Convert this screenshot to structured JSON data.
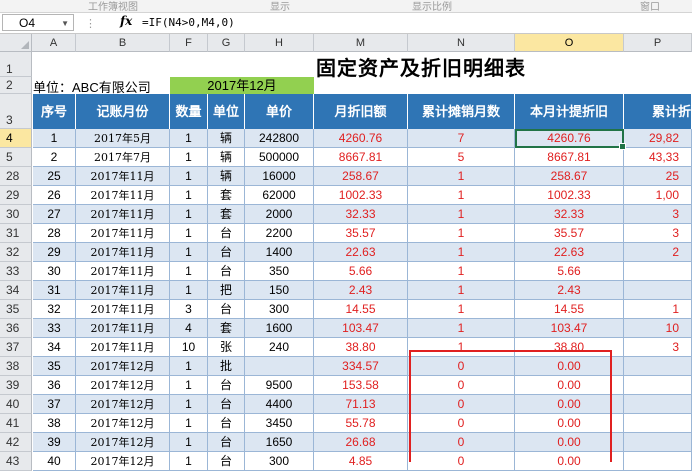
{
  "ribbon": {
    "groups": [
      "工作簿视图",
      "显示",
      "显示比例",
      "窗口"
    ]
  },
  "formula_bar": {
    "name_box": "O4",
    "fx": "fx",
    "formula": "=IF(N4>0,M4,0)"
  },
  "columns": [
    "A",
    "B",
    "F",
    "G",
    "H",
    "M",
    "N",
    "O",
    "P"
  ],
  "selected_column": "O",
  "sheet": {
    "title": "固定资产及折旧明细表",
    "unit": "单位：ABC有限公司",
    "month": "2017年12月"
  },
  "headers": [
    "序号",
    "记账月份",
    "数量",
    "单位",
    "单价",
    "月折旧额",
    "累计摊销月数",
    "本月计提折旧",
    "累计折"
  ],
  "rows": [
    {
      "row": "4",
      "seq": "1",
      "month": "2017年5月",
      "qty": "1",
      "unit": "辆",
      "price": "242800",
      "dep": "4260.76",
      "months": "7",
      "cur": "4260.76",
      "acc": "29,82"
    },
    {
      "row": "5",
      "seq": "2",
      "month": "2017年7月",
      "qty": "1",
      "unit": "辆",
      "price": "500000",
      "dep": "8667.81",
      "months": "5",
      "cur": "8667.81",
      "acc": "43,33"
    },
    {
      "row": "28",
      "seq": "25",
      "month": "2017年11月",
      "qty": "1",
      "unit": "辆",
      "price": "16000",
      "dep": "258.67",
      "months": "1",
      "cur": "258.67",
      "acc": "25"
    },
    {
      "row": "29",
      "seq": "26",
      "month": "2017年11月",
      "qty": "1",
      "unit": "套",
      "price": "62000",
      "dep": "1002.33",
      "months": "1",
      "cur": "1002.33",
      "acc": "1,00"
    },
    {
      "row": "30",
      "seq": "27",
      "month": "2017年11月",
      "qty": "1",
      "unit": "套",
      "price": "2000",
      "dep": "32.33",
      "months": "1",
      "cur": "32.33",
      "acc": "3"
    },
    {
      "row": "31",
      "seq": "28",
      "month": "2017年11月",
      "qty": "1",
      "unit": "台",
      "price": "2200",
      "dep": "35.57",
      "months": "1",
      "cur": "35.57",
      "acc": "3"
    },
    {
      "row": "32",
      "seq": "29",
      "month": "2017年11月",
      "qty": "1",
      "unit": "台",
      "price": "1400",
      "dep": "22.63",
      "months": "1",
      "cur": "22.63",
      "acc": "2"
    },
    {
      "row": "33",
      "seq": "30",
      "month": "2017年11月",
      "qty": "1",
      "unit": "台",
      "price": "350",
      "dep": "5.66",
      "months": "1",
      "cur": "5.66",
      "acc": ""
    },
    {
      "row": "34",
      "seq": "31",
      "month": "2017年11月",
      "qty": "1",
      "unit": "把",
      "price": "150",
      "dep": "2.43",
      "months": "1",
      "cur": "2.43",
      "acc": ""
    },
    {
      "row": "35",
      "seq": "32",
      "month": "2017年11月",
      "qty": "3",
      "unit": "台",
      "price": "300",
      "dep": "14.55",
      "months": "1",
      "cur": "14.55",
      "acc": "1"
    },
    {
      "row": "36",
      "seq": "33",
      "month": "2017年11月",
      "qty": "4",
      "unit": "套",
      "price": "1600",
      "dep": "103.47",
      "months": "1",
      "cur": "103.47",
      "acc": "10"
    },
    {
      "row": "37",
      "seq": "34",
      "month": "2017年11月",
      "qty": "10",
      "unit": "张",
      "price": "240",
      "dep": "38.80",
      "months": "1",
      "cur": "38.80",
      "acc": "3"
    },
    {
      "row": "38",
      "seq": "35",
      "month": "2017年12月",
      "qty": "1",
      "unit": "批",
      "price": "",
      "dep": "334.57",
      "months": "0",
      "cur": "0.00",
      "acc": ""
    },
    {
      "row": "39",
      "seq": "36",
      "month": "2017年12月",
      "qty": "1",
      "unit": "台",
      "price": "9500",
      "dep": "153.58",
      "months": "0",
      "cur": "0.00",
      "acc": ""
    },
    {
      "row": "40",
      "seq": "37",
      "month": "2017年12月",
      "qty": "1",
      "unit": "台",
      "price": "4400",
      "dep": "71.13",
      "months": "0",
      "cur": "0.00",
      "acc": ""
    },
    {
      "row": "41",
      "seq": "38",
      "month": "2017年12月",
      "qty": "1",
      "unit": "台",
      "price": "3450",
      "dep": "55.78",
      "months": "0",
      "cur": "0.00",
      "acc": ""
    },
    {
      "row": "42",
      "seq": "39",
      "month": "2017年12月",
      "qty": "1",
      "unit": "台",
      "price": "1650",
      "dep": "26.68",
      "months": "0",
      "cur": "0.00",
      "acc": ""
    },
    {
      "row": "43",
      "seq": "40",
      "month": "2017年12月",
      "qty": "1",
      "unit": "台",
      "price": "300",
      "dep": "4.85",
      "months": "0",
      "cur": "0.00",
      "acc": ""
    }
  ],
  "colors": {
    "header_blue": "#2f75b5",
    "row_light": "#dce6f2",
    "row_white": "#ffffff",
    "month_green": "#92d050",
    "red_text": "#e02020",
    "highlight_box": "#e02020",
    "active_cell": "#217346"
  }
}
